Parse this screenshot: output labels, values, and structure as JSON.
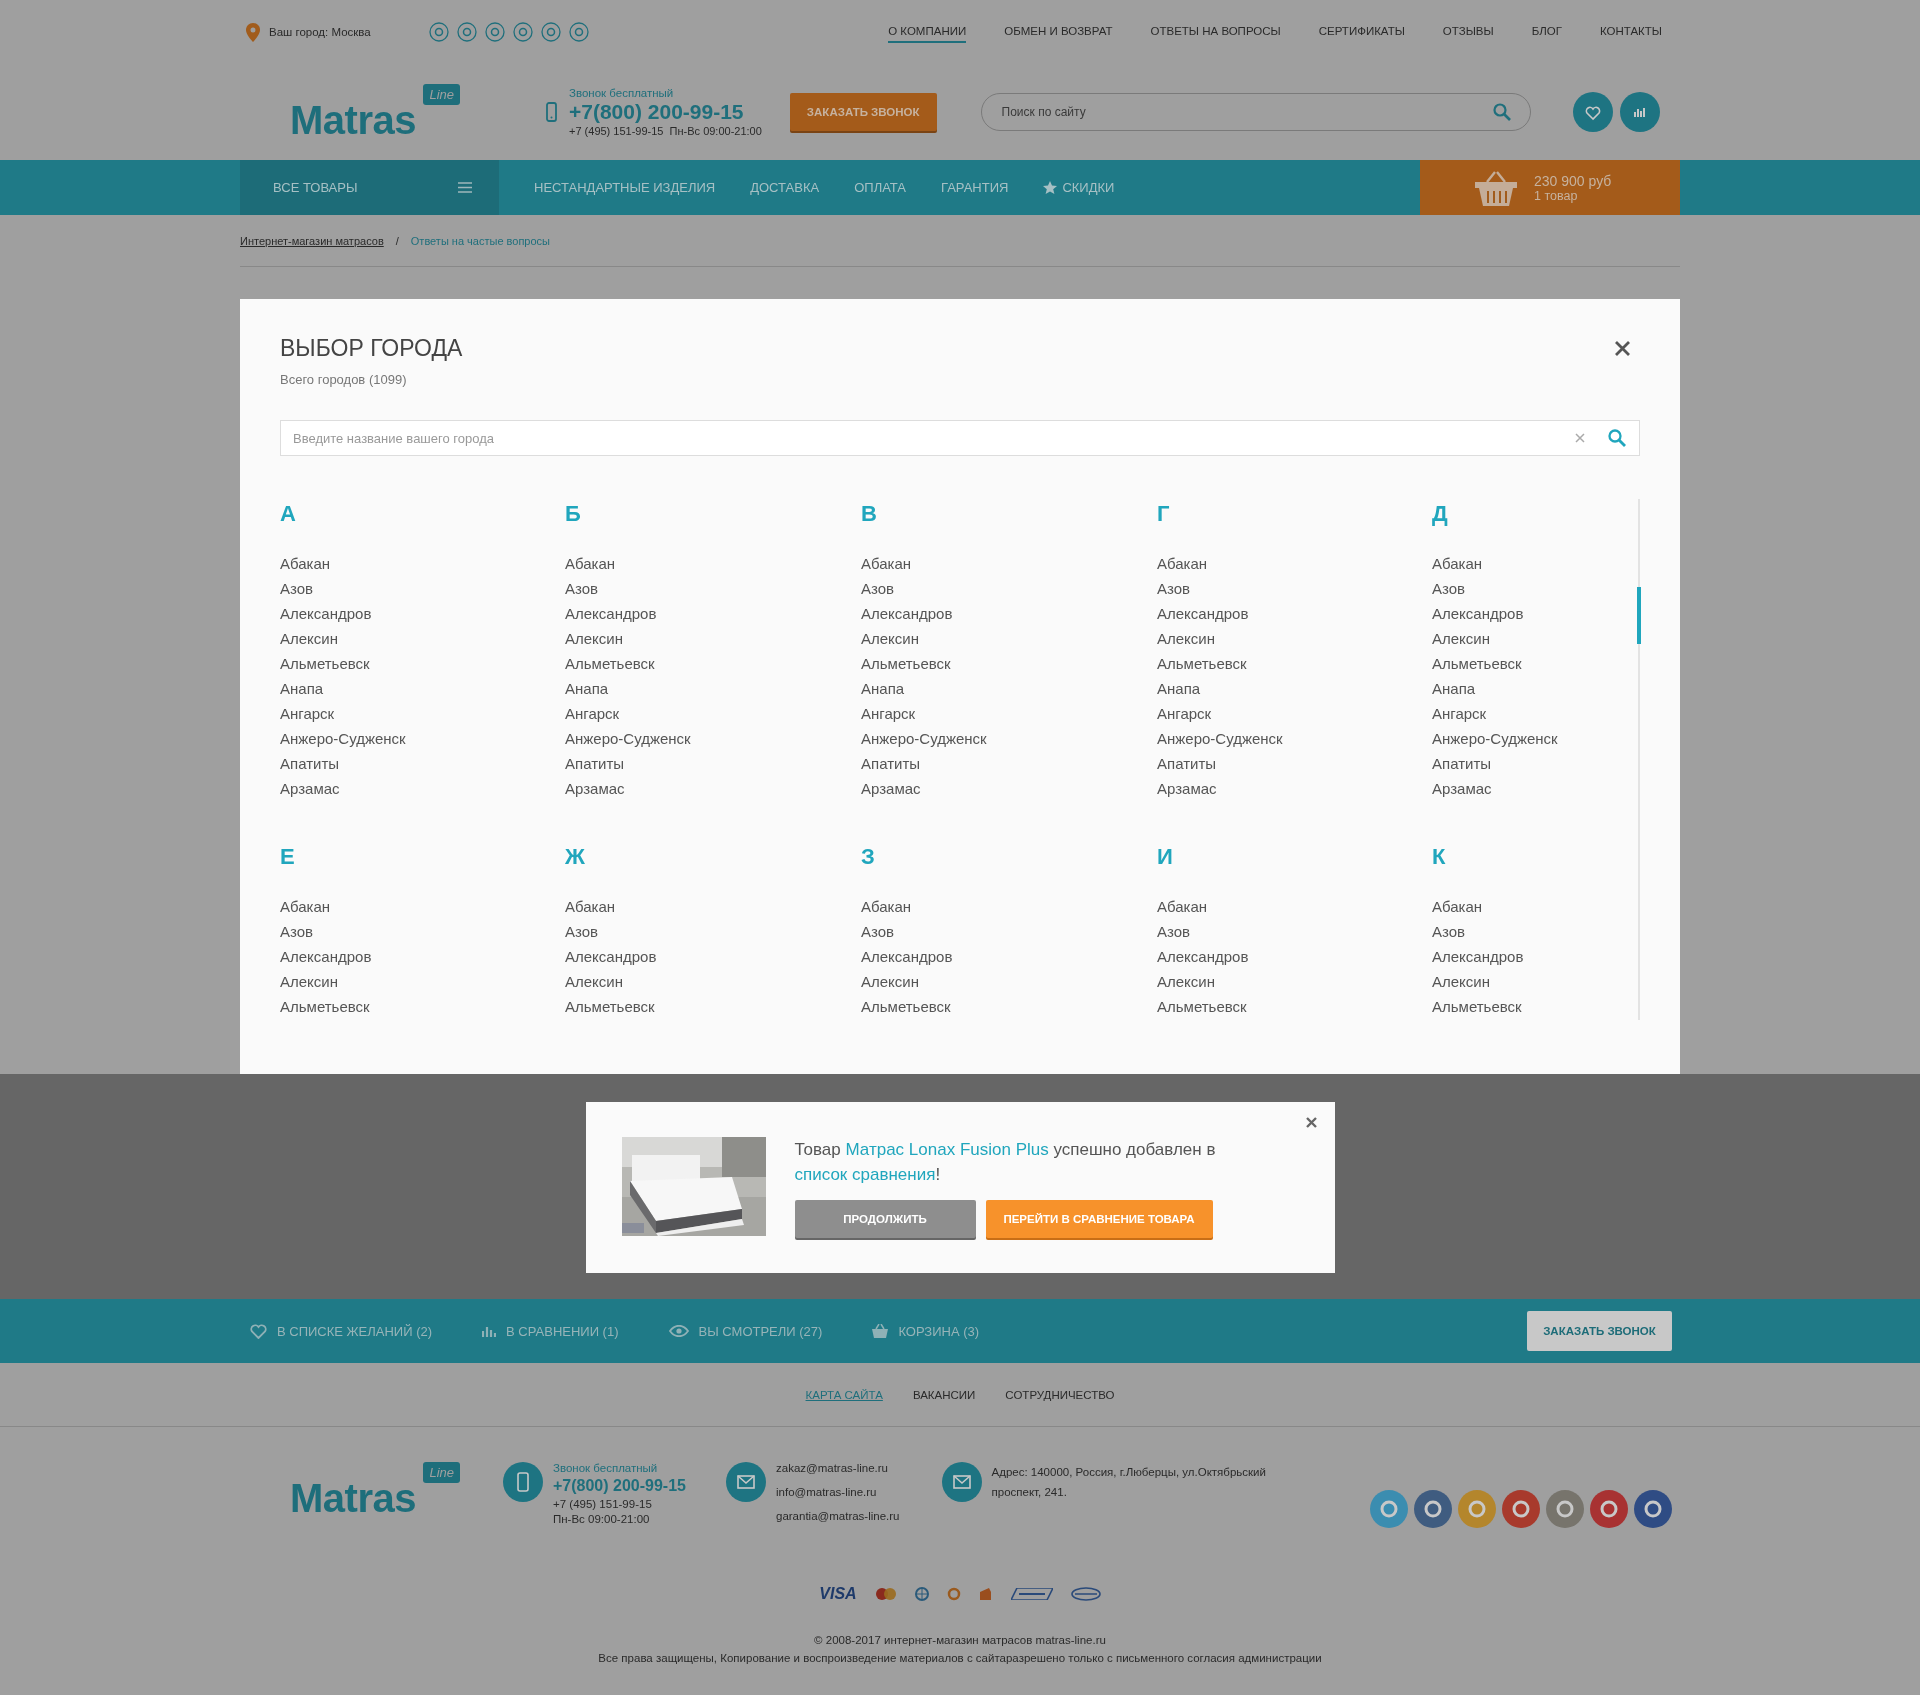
{
  "top_bar": {
    "city": "Ваш город: Москва",
    "menu": [
      {
        "label": "О КОМПАНИИ",
        "selected": true
      },
      {
        "label": "ОБМЕН И ВОЗВРАТ",
        "selected": false
      },
      {
        "label": "ОТВЕТЫ НА ВОПРОСЫ",
        "selected": false
      },
      {
        "label": "СЕРТИФИКАТЫ",
        "selected": false
      },
      {
        "label": "ОТЗЫВЫ",
        "selected": false
      },
      {
        "label": "БЛОГ",
        "selected": false
      },
      {
        "label": "КОНТАКТЫ",
        "selected": false
      }
    ]
  },
  "header": {
    "logo": {
      "name": "Matras",
      "badge": "Line"
    },
    "phone": {
      "note": "Звонок бесплатный",
      "number": "+7(800) 200-99-15",
      "extra": "+7 (495) 151-99-15  Пн-Вс 09:00-21:00"
    },
    "callback_button": "ЗАКАЗАТЬ ЗВОНОК",
    "search": {
      "placeholder": "Поиск по сайту"
    }
  },
  "nav": {
    "catalog": "ВСЕ ТОВАРЫ",
    "items": [
      {
        "label": "НЕСТАНДАРТНЫЕ ИЗДЕЛИЯ",
        "kind": "plain"
      },
      {
        "label": "ДОСТАВКА",
        "kind": "plain"
      },
      {
        "label": "ОПЛАТА",
        "kind": "plain"
      },
      {
        "label": "ГАРАНТИЯ",
        "kind": "plain"
      },
      {
        "label": "СКИДКИ",
        "kind": "star"
      }
    ],
    "cart": {
      "total": "230 900 руб",
      "count": "1 товар"
    }
  },
  "breadcrumbs": [
    "Интернет-магазин матрасов",
    "/",
    "Ответы на частые вопросы"
  ],
  "city_modal": {
    "title": "ВЫБОР ГОРОДА",
    "subtitle": "Всего городов (1099)",
    "search": {
      "placeholder": "Введите название вашего города"
    },
    "groups": [
      {
        "letter": "А",
        "cities": [
          "Абакан",
          "Азов",
          "Александров",
          "Алексин",
          "Альметьевск",
          "Анапа",
          "Ангарск",
          "Анжеро-Судженск",
          "Апатиты",
          "Арзамас"
        ]
      },
      {
        "letter": "Б",
        "cities": [
          "Абакан",
          "Азов",
          "Александров",
          "Алексин",
          "Альметьевск",
          "Анапа",
          "Ангарск",
          "Анжеро-Судженск",
          "Апатиты",
          "Арзамас"
        ]
      },
      {
        "letter": "В",
        "cities": [
          "Абакан",
          "Азов",
          "Александров",
          "Алексин",
          "Альметьевск",
          "Анапа",
          "Ангарск",
          "Анжеро-Судженск",
          "Апатиты",
          "Арзамас"
        ]
      },
      {
        "letter": "Г",
        "cities": [
          "Абакан",
          "Азов",
          "Александров",
          "Алексин",
          "Альметьевск",
          "Анапа",
          "Ангарск",
          "Анжеро-Судженск",
          "Апатиты",
          "Арзамас"
        ]
      },
      {
        "letter": "Д",
        "cities": [
          "Абакан",
          "Азов",
          "Александров",
          "Алексин",
          "Альметьевск",
          "Анапа",
          "Ангарск",
          "Анжеро-Судженск",
          "Апатиты",
          "Арзамас"
        ]
      },
      {
        "letter": "Е",
        "cities": [
          "Абакан",
          "Азов",
          "Александров",
          "Алексин",
          "Альметьевск"
        ]
      },
      {
        "letter": "Ж",
        "cities": [
          "Абакан",
          "Азов",
          "Александров",
          "Алексин",
          "Альметьевск"
        ]
      },
      {
        "letter": "З",
        "cities": [
          "Абакан",
          "Азов",
          "Александров",
          "Алексин",
          "Альметьевск"
        ]
      },
      {
        "letter": "И",
        "cities": [
          "Абакан",
          "Азов",
          "Александров",
          "Алексин",
          "Альметьевск"
        ]
      },
      {
        "letter": "К",
        "cities": [
          "Абакан",
          "Азов",
          "Александров",
          "Алексин",
          "Альметьевск"
        ]
      }
    ]
  },
  "popup": {
    "prefix": "Товар",
    "product": "Матрас Lonax Fusion Plus",
    "middle": "успешно добавлен в",
    "link": "список сравнения",
    "suffix": "!",
    "buttons": [
      {
        "label": "ПРОДОЛЖИТЬ",
        "kind": "secondary"
      },
      {
        "label": "ПЕРЕЙТИ В СРАВНЕНИЕ ТОВАРА",
        "kind": "primary"
      }
    ]
  },
  "bottom_bar": {
    "items": [
      {
        "label": "В СПИСКЕ ЖЕЛАНИЙ (2)",
        "kind": "heart"
      },
      {
        "label": "В СРАВНЕНИИ (1)",
        "kind": "chart"
      },
      {
        "label": "ВЫ СМОТРЕЛИ (27)",
        "kind": "eye"
      },
      {
        "label": "КОРЗИНА (3)",
        "kind": "basket"
      }
    ],
    "button": "ЗАКАЗАТЬ ЗВОНОК"
  },
  "footer": {
    "links": [
      {
        "label": "КАРТА САЙТА",
        "selected": true
      },
      {
        "label": "ВАКАНСИИ",
        "selected": false
      },
      {
        "label": "СОТРУДНИЧЕСТВО",
        "selected": false
      }
    ],
    "logo": {
      "name": "Matras",
      "badge": "Line"
    },
    "phone": {
      "note": "Звонок бесплатный",
      "number": "+7(800) 200-99-15",
      "extra": "+7 (495) 151-99-15",
      "hours": "Пн-Вс 09:00-21:00"
    },
    "emails": [
      "zakaz@matras-line.ru",
      "info@matras-line.ru",
      "garantia@matras-line.ru"
    ],
    "address": "Адрес: 140000, Россия, г.Люберцы, ул.Октябрьский проспект, 241.",
    "social": [
      {
        "color": "#3b8db0"
      },
      {
        "color": "#3f5c80"
      },
      {
        "color": "#b4862c"
      },
      {
        "color": "#a83a2c"
      },
      {
        "color": "#77746c"
      },
      {
        "color": "#a83232"
      },
      {
        "color": "#2f4c84"
      }
    ],
    "payment_label": "VISA",
    "copyright": "© 2008-2017 интернет-магазин матрасов matras-line.ru",
    "rights": "Все права защищены, Копирование и воспроизведение материалов с сайтаразрешено только с письменного согласия администрации"
  }
}
